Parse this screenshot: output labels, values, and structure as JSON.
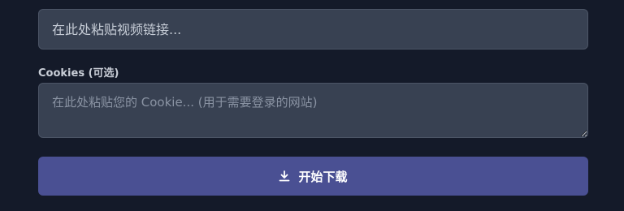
{
  "url_field": {
    "placeholder": "在此处粘贴视频链接...",
    "value": ""
  },
  "cookies": {
    "label": "Cookies (可选)",
    "placeholder": "在此处粘贴您的 Cookie... (用于需要登录的网站)",
    "value": ""
  },
  "download": {
    "label": "开始下载",
    "icon": "download-icon"
  },
  "colors": {
    "background": "#141a29",
    "field_background": "#384152",
    "button_background": "#4a5093"
  }
}
